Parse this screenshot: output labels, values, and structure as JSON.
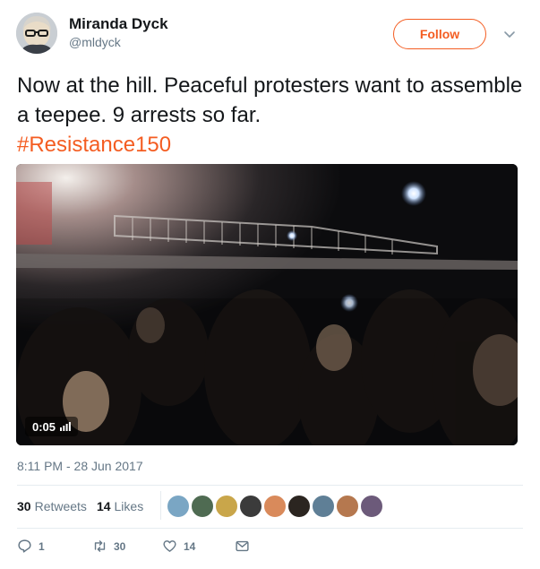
{
  "author": {
    "name": "Miranda Dyck",
    "handle": "@mldyck"
  },
  "follow_button": {
    "label": "Follow"
  },
  "tweet": {
    "text": "Now at the hill. Peaceful protesters want to assemble a teepee. 9 arrests so far.",
    "hashtag": "#Resistance150"
  },
  "video": {
    "elapsed": "0:05"
  },
  "timestamp": "8:11 PM - 28 Jun 2017",
  "stats": {
    "retweets_count": "30",
    "retweets_label": "Retweets",
    "likes_count": "14",
    "likes_label": "Likes"
  },
  "actions": {
    "replies": "1",
    "retweets": "30",
    "likes": "14"
  },
  "colors": {
    "accent": "#f45d22",
    "secondary_text": "#657786",
    "primary_text": "#14171a",
    "divider": "#e6ecf0"
  },
  "icons": {
    "caret": "chevron-down-icon",
    "reply": "reply-icon",
    "retweet": "retweet-icon",
    "like": "heart-icon",
    "message": "envelope-icon",
    "volume": "volume-bars-icon"
  }
}
